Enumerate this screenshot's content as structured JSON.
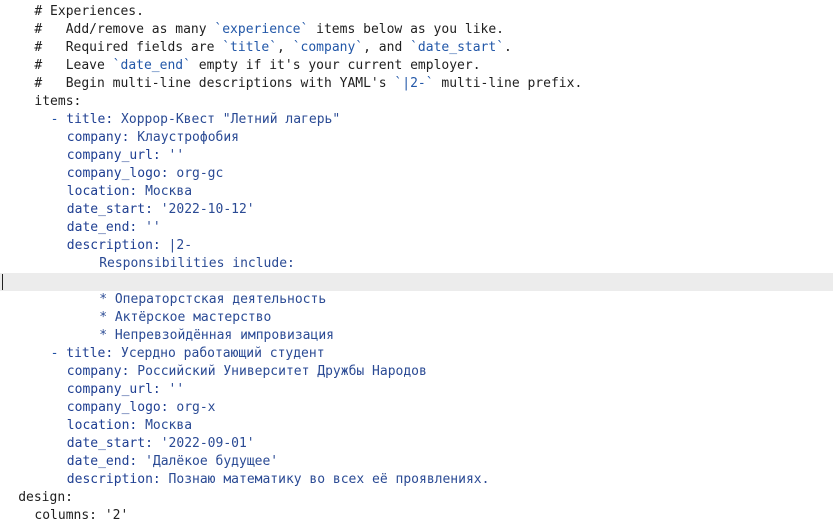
{
  "lines": [
    {
      "indent": "    ",
      "parts": [
        {
          "cls": "c",
          "text": "# Experiences."
        }
      ]
    },
    {
      "indent": "    ",
      "parts": [
        {
          "cls": "c",
          "text": "#   Add/remove as many "
        },
        {
          "cls": "t",
          "text": "`experience`"
        },
        {
          "cls": "c",
          "text": " items below as you like."
        }
      ]
    },
    {
      "indent": "    ",
      "parts": [
        {
          "cls": "c",
          "text": "#   Required fields are "
        },
        {
          "cls": "t",
          "text": "`title`"
        },
        {
          "cls": "c",
          "text": ", "
        },
        {
          "cls": "t",
          "text": "`company`"
        },
        {
          "cls": "c",
          "text": ", and "
        },
        {
          "cls": "t",
          "text": "`date_start`"
        },
        {
          "cls": "c",
          "text": "."
        }
      ]
    },
    {
      "indent": "    ",
      "parts": [
        {
          "cls": "c",
          "text": "#   Leave "
        },
        {
          "cls": "t",
          "text": "`date_end`"
        },
        {
          "cls": "c",
          "text": " empty if it's your current employer."
        }
      ]
    },
    {
      "indent": "    ",
      "parts": [
        {
          "cls": "c",
          "text": "#   Begin multi-line descriptions with YAML's "
        },
        {
          "cls": "t",
          "text": "`|2-`"
        },
        {
          "cls": "c",
          "text": " multi-line prefix."
        }
      ]
    },
    {
      "indent": "    ",
      "parts": [
        {
          "cls": "k",
          "text": "items:"
        }
      ]
    },
    {
      "indent": "      ",
      "parts": [
        {
          "cls": "p",
          "text": "- "
        },
        {
          "cls": "kb",
          "text": "title: "
        },
        {
          "cls": "v",
          "text": "Хоррор-Квест \"Летний лагерь\""
        }
      ]
    },
    {
      "indent": "        ",
      "parts": [
        {
          "cls": "kb",
          "text": "company: "
        },
        {
          "cls": "v",
          "text": "Клаустрофобия"
        }
      ]
    },
    {
      "indent": "        ",
      "parts": [
        {
          "cls": "kb",
          "text": "company_url: "
        },
        {
          "cls": "v",
          "text": "''"
        }
      ]
    },
    {
      "indent": "        ",
      "parts": [
        {
          "cls": "kb",
          "text": "company_logo: "
        },
        {
          "cls": "v",
          "text": "org-gc"
        }
      ]
    },
    {
      "indent": "        ",
      "parts": [
        {
          "cls": "kb",
          "text": "location: "
        },
        {
          "cls": "v",
          "text": "Москва"
        }
      ]
    },
    {
      "indent": "        ",
      "parts": [
        {
          "cls": "kb",
          "text": "date_start: "
        },
        {
          "cls": "v",
          "text": "'2022-10-12'"
        }
      ]
    },
    {
      "indent": "        ",
      "parts": [
        {
          "cls": "kb",
          "text": "date_end: "
        },
        {
          "cls": "v",
          "text": "''"
        }
      ]
    },
    {
      "indent": "        ",
      "parts": [
        {
          "cls": "kb",
          "text": "description: "
        },
        {
          "cls": "v",
          "text": "|2-"
        }
      ]
    },
    {
      "indent": "            ",
      "parts": [
        {
          "cls": "v",
          "text": "Responsibilities include:"
        }
      ]
    },
    {
      "indent": "",
      "parts": [],
      "current": true
    },
    {
      "indent": "            ",
      "parts": [
        {
          "cls": "v",
          "text": "* Операторстская деятельность"
        }
      ]
    },
    {
      "indent": "            ",
      "parts": [
        {
          "cls": "v",
          "text": "* Актёрское мастерство"
        }
      ]
    },
    {
      "indent": "            ",
      "parts": [
        {
          "cls": "v",
          "text": "* Непревзойдённая импровизация"
        }
      ]
    },
    {
      "indent": "      ",
      "parts": [
        {
          "cls": "p",
          "text": "- "
        },
        {
          "cls": "kb",
          "text": "title: "
        },
        {
          "cls": "v",
          "text": "Усердно работающий студент"
        }
      ]
    },
    {
      "indent": "        ",
      "parts": [
        {
          "cls": "kb",
          "text": "company: "
        },
        {
          "cls": "v",
          "text": "Российский Университет Дружбы Народов"
        }
      ]
    },
    {
      "indent": "        ",
      "parts": [
        {
          "cls": "kb",
          "text": "company_url: "
        },
        {
          "cls": "v",
          "text": "''"
        }
      ]
    },
    {
      "indent": "        ",
      "parts": [
        {
          "cls": "kb",
          "text": "company_logo: "
        },
        {
          "cls": "v",
          "text": "org-x"
        }
      ]
    },
    {
      "indent": "        ",
      "parts": [
        {
          "cls": "kb",
          "text": "location: "
        },
        {
          "cls": "v",
          "text": "Москва"
        }
      ]
    },
    {
      "indent": "        ",
      "parts": [
        {
          "cls": "kb",
          "text": "date_start: "
        },
        {
          "cls": "v",
          "text": "'2022-09-01'"
        }
      ]
    },
    {
      "indent": "        ",
      "parts": [
        {
          "cls": "kb",
          "text": "date_end: "
        },
        {
          "cls": "v",
          "text": "'Далёкое будущее'"
        }
      ]
    },
    {
      "indent": "        ",
      "parts": [
        {
          "cls": "kb",
          "text": "description: "
        },
        {
          "cls": "v",
          "text": "Познаю математику во всех её проявлениях."
        }
      ]
    },
    {
      "indent": "  ",
      "parts": [
        {
          "cls": "k",
          "text": "design:"
        }
      ]
    },
    {
      "indent": "    ",
      "parts": [
        {
          "cls": "k",
          "text": "columns: "
        },
        {
          "cls": "k",
          "text": "'2'"
        }
      ]
    }
  ]
}
